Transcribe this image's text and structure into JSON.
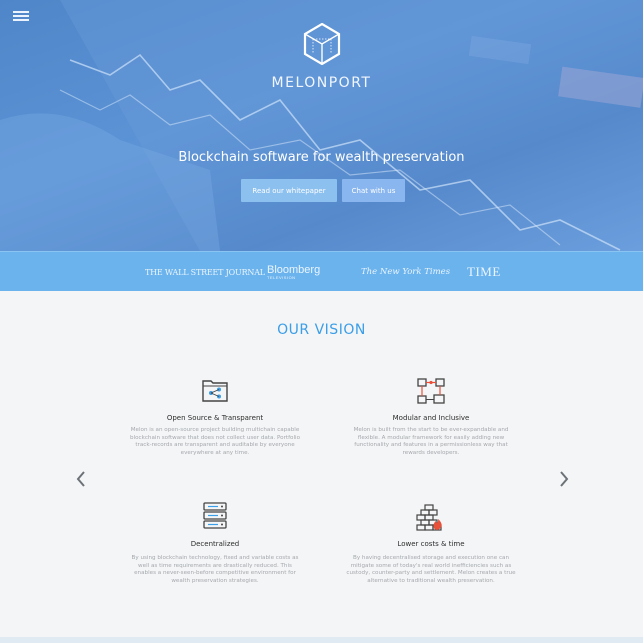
{
  "header": {
    "brand_name": "MELONPORT",
    "tagline": "Blockchain software for wealth preservation",
    "buttons": {
      "whitepaper": "Read our whitepaper",
      "chat": "Chat with us"
    },
    "icons": [
      "menu-icon",
      "melonport-cube-logo"
    ]
  },
  "press": {
    "logos": [
      "THE WALL STREET JOURNAL",
      "Bloomberg",
      "TELEVISION",
      "The New York Times",
      "TIME"
    ]
  },
  "vision": {
    "title": "OUR VISION",
    "features": [
      {
        "title": "Open Source & Transparent",
        "icon": "folder-share-icon",
        "description": "Melon is an open-source project building multichain capable blockchain software that does not collect user data. Portfolio track-records are transparent and auditable by everyone everywhere at any time."
      },
      {
        "title": "Modular and Inclusive",
        "icon": "network-modules-icon",
        "description": "Melon is built from the start to be ever-expandable and flexible. A modular framework for easily adding new functionality and features in a permissionless way that rewards developers."
      },
      {
        "title": "Decentralized",
        "icon": "server-stack-icon",
        "description": "By using blockchain technology, fixed and variable costs as well as time requirements are drastically reduced. This enables a never-seen-before competitive environment for wealth preservation strategies."
      },
      {
        "title": "Lower costs & time",
        "icon": "firewall-icon",
        "description": "By having decentralised storage and execution one can mitigate some of today's real world inefficiencies such as custody, counter-party and settlement. Melon creates a true alternative to traditional wealth preservation."
      }
    ],
    "nav": [
      "chevron-left-icon",
      "chevron-right-icon"
    ]
  },
  "colors": {
    "hero_blue": "#5b93d6",
    "press_blue": "#6bb3ed",
    "accent_blue": "#3a9ee8",
    "button_blue": "#8cc0ef",
    "icon_red": "#e8503a"
  }
}
